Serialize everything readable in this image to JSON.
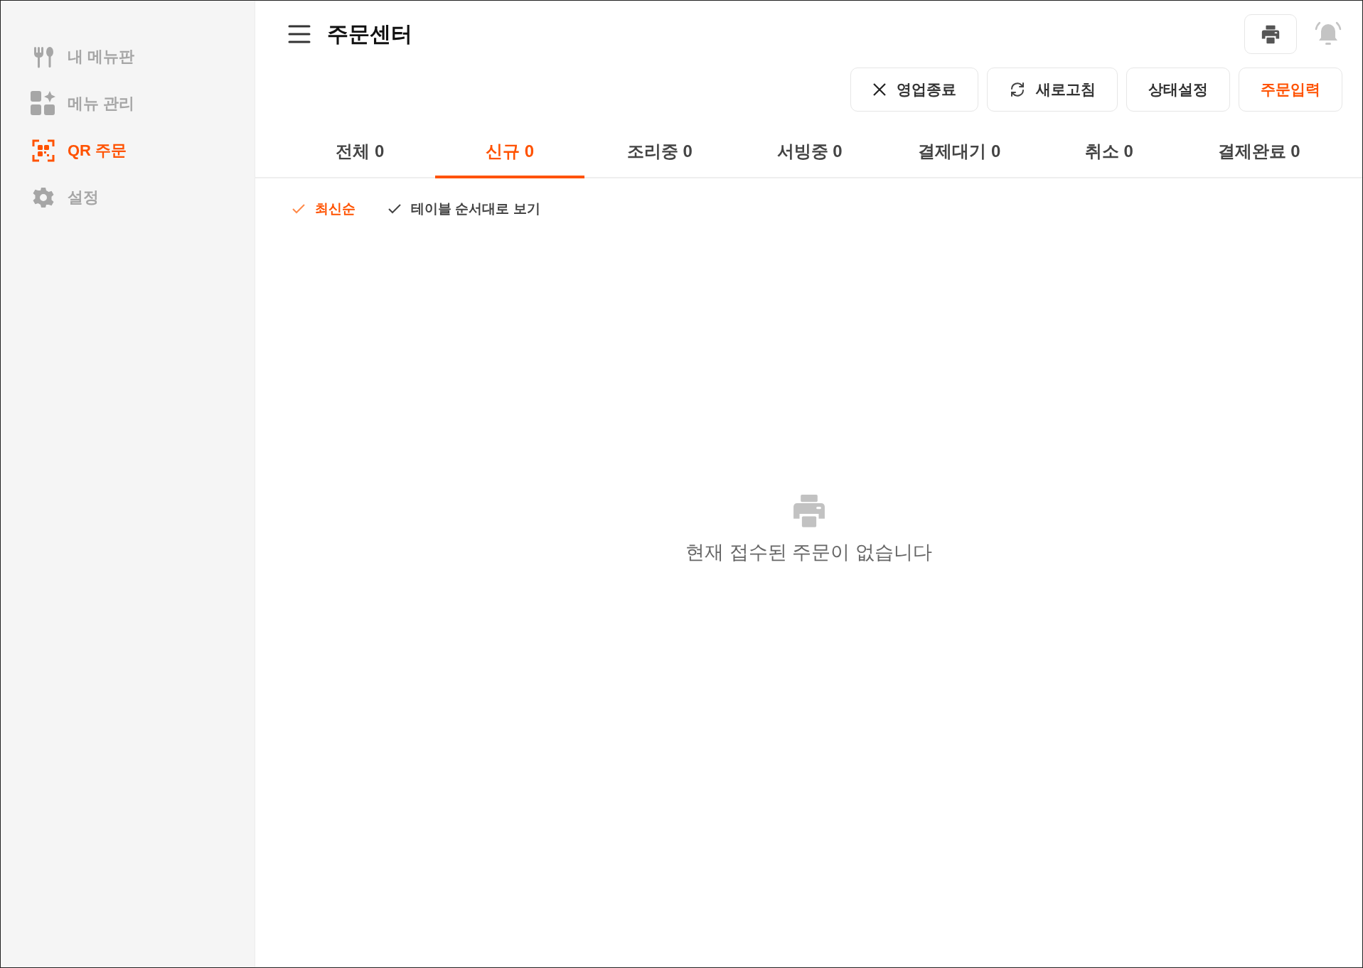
{
  "sidebar": {
    "items": [
      {
        "kind": "menu",
        "label": "내 메뉴판",
        "selected": false
      },
      {
        "kind": "manage",
        "label": "메뉴 관리",
        "selected": false
      },
      {
        "kind": "qr",
        "label": "QR 주문",
        "selected": true
      },
      {
        "kind": "settings",
        "label": "설정",
        "selected": false
      }
    ]
  },
  "header": {
    "title": "주문센터"
  },
  "actions": [
    {
      "kind": "close",
      "label": "영업종료"
    },
    {
      "kind": "refresh",
      "label": "새로고침"
    },
    {
      "kind": "plain",
      "label": "상태설정"
    },
    {
      "kind": "primary",
      "label": "주문입력"
    }
  ],
  "tabs": [
    {
      "label": "전체 0",
      "selected": false
    },
    {
      "label": "신규 0",
      "selected": true
    },
    {
      "label": "조리중 0",
      "selected": false
    },
    {
      "label": "서빙중 0",
      "selected": false
    },
    {
      "label": "결제대기 0",
      "selected": false
    },
    {
      "label": "취소 0",
      "selected": false
    },
    {
      "label": "결제완료 0",
      "selected": false
    }
  ],
  "sort_options": [
    {
      "label": "최신순",
      "selected": true
    },
    {
      "label": "테이블 순서대로 보기",
      "selected": false
    }
  ],
  "empty_state": {
    "message": "현재 접수된 주문이 없습니다"
  }
}
